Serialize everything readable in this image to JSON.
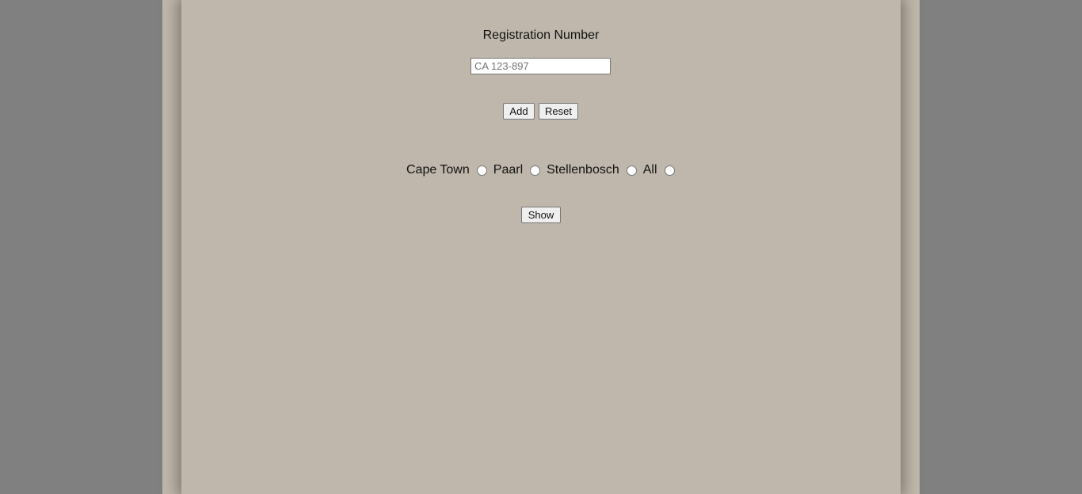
{
  "form": {
    "title": "Registration Number",
    "input_placeholder": "CA 123-897",
    "input_value": "",
    "add_label": "Add",
    "reset_label": "Reset",
    "show_label": "Show"
  },
  "towns": [
    {
      "label": "Cape Town",
      "selected": false
    },
    {
      "label": "Paarl",
      "selected": false
    },
    {
      "label": "Stellenbosch",
      "selected": false
    },
    {
      "label": "All",
      "selected": false
    }
  ]
}
